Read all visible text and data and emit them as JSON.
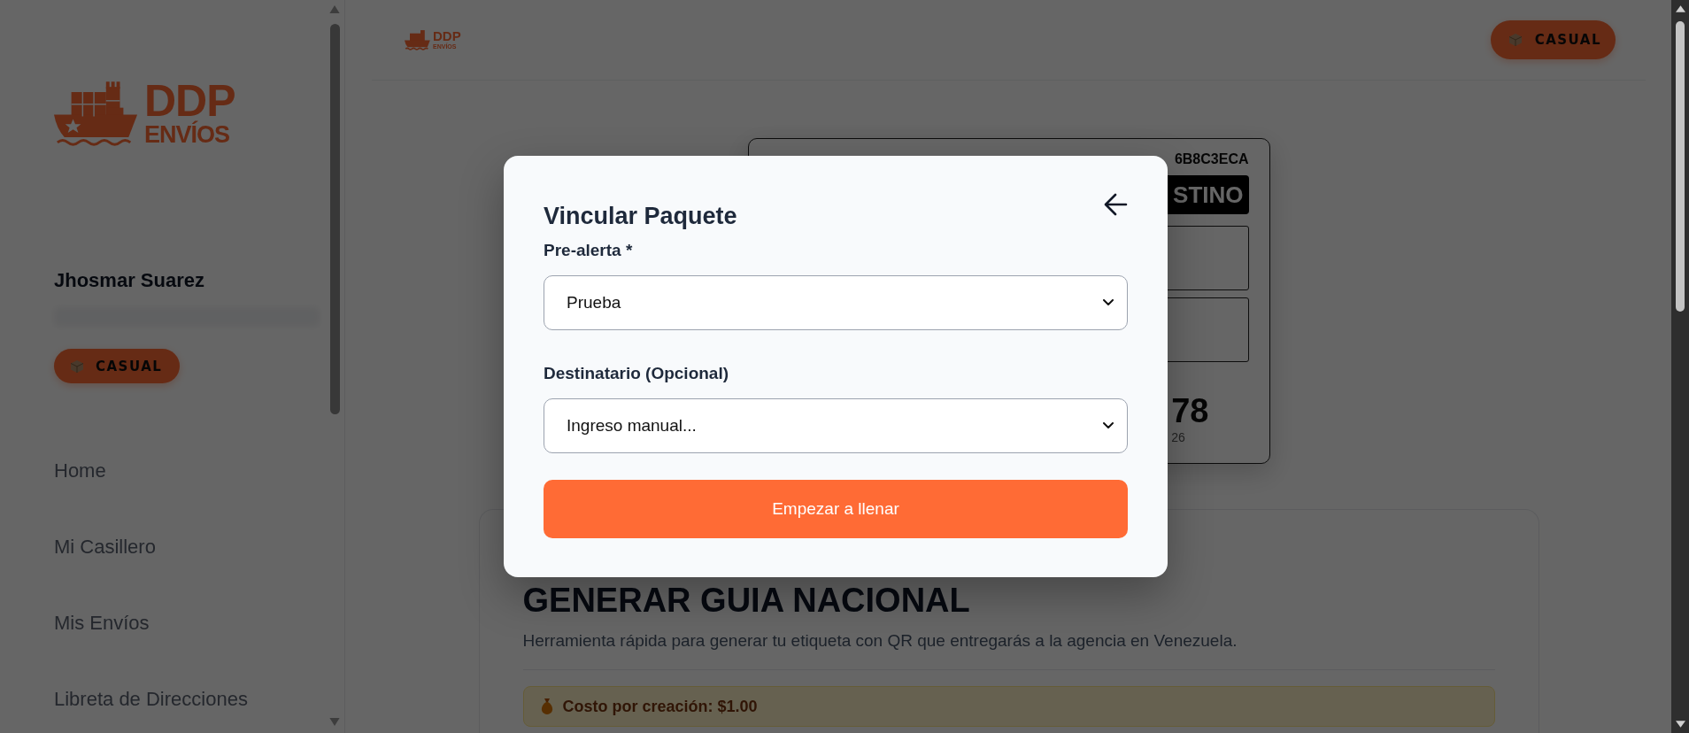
{
  "sidebar": {
    "logo": {
      "title": "DDP",
      "subtitle": "ENVÍOS"
    },
    "user": {
      "name": "Jhosmar Suarez",
      "plan": "CASUAL"
    },
    "nav": [
      {
        "label": "Home"
      },
      {
        "label": "Mi Casillero"
      },
      {
        "label": "Mis Envíos"
      },
      {
        "label": "Libreta de Direcciones"
      }
    ]
  },
  "header": {
    "logo": {
      "title": "DDP",
      "subtitle": "ENVÍOS"
    },
    "plan": "CASUAL"
  },
  "label_preview": {
    "code": "6B8C3ECA",
    "banner": "STINO",
    "number": "78",
    "caption": "26"
  },
  "guide_card": {
    "title": "GENERAR GUIA NACIONAL",
    "subtitle": "Herramienta rápida para generar tu etiqueta con QR que entregarás a la agencia en Venezuela.",
    "notice": "Costo por creación: $1.00"
  },
  "modal": {
    "title": "Vincular Paquete",
    "fields": [
      {
        "label": "Pre-alerta *",
        "value": "Prueba"
      },
      {
        "label": "Destinatario (Opcional)",
        "value": "Ingreso manual..."
      }
    ],
    "submit": "Empezar a llenar"
  }
}
